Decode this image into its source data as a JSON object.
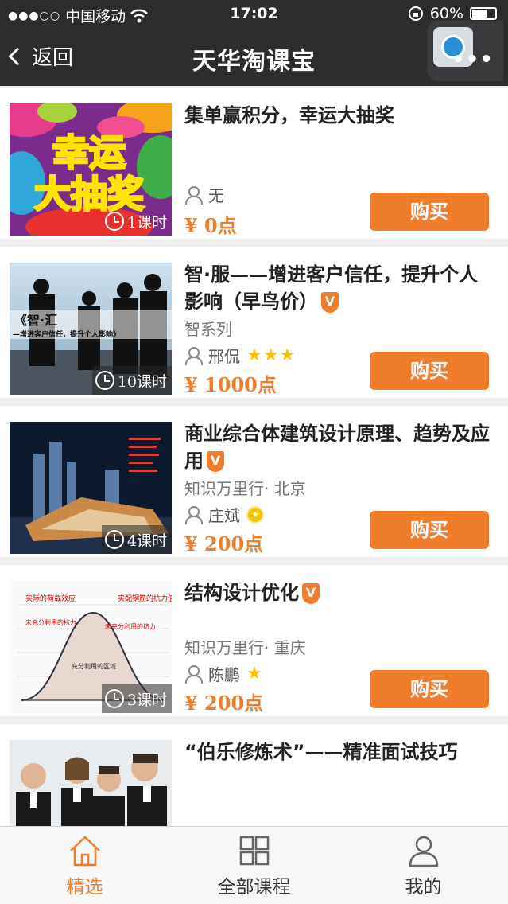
{
  "status": {
    "carrier": "中国移动",
    "time": "17:02",
    "battery": "60%"
  },
  "nav": {
    "back_label": "返回",
    "title": "天华淘课宝"
  },
  "courses": [
    {
      "title": "集单赢积分，幸运大抽奖",
      "series": "",
      "author": "无",
      "stars": "",
      "price": "¥ 0点",
      "lessons": "1课时",
      "buy": "购买",
      "verified": false,
      "thumb_text": [
        "幸运",
        "大抽奖"
      ]
    },
    {
      "title": "智·服——增进客户信任，提升个人影响（早鸟价）",
      "series": "智系列",
      "author": "邢侃",
      "stars": "★★★",
      "price": "¥ 1000点",
      "lessons": "10课时",
      "buy": "购买",
      "verified": true,
      "thumb_text": [
        "《智·汇",
        "—增进客户信任，提升个人影响》"
      ]
    },
    {
      "title": "商业综合体建筑设计原理、趋势及应用",
      "series": "知识万里行· 北京",
      "author": "庄斌",
      "stars": "",
      "price": "¥ 200点",
      "lessons": "4课时",
      "buy": "购买",
      "verified": true
    },
    {
      "title": "结构设计优化",
      "series": "知识万里行· 重庆",
      "author": "陈鹏",
      "stars": "★",
      "price": "¥ 200点",
      "lessons": "3课时",
      "buy": "购买",
      "verified": true,
      "thumb_text": [
        "实际的荷载效应",
        "实配钢筋的抗力值",
        "未充分利用的抗力",
        "未充分利用的抗力",
        "充分利用的区域"
      ]
    },
    {
      "title": "“伯乐修炼术”——精准面试技巧",
      "series": "",
      "author": "",
      "stars": "",
      "price": "",
      "lessons": "",
      "buy": "",
      "verified": false
    }
  ],
  "tabs": [
    {
      "label": "精选",
      "icon": "home-icon",
      "active": true
    },
    {
      "label": "全部课程",
      "icon": "grid-icon",
      "active": false
    },
    {
      "label": "我的",
      "icon": "user-icon",
      "active": false
    }
  ],
  "colors": {
    "accent": "#ef7d2c",
    "navbar": "#2c2c2e",
    "star": "#f5c400"
  }
}
